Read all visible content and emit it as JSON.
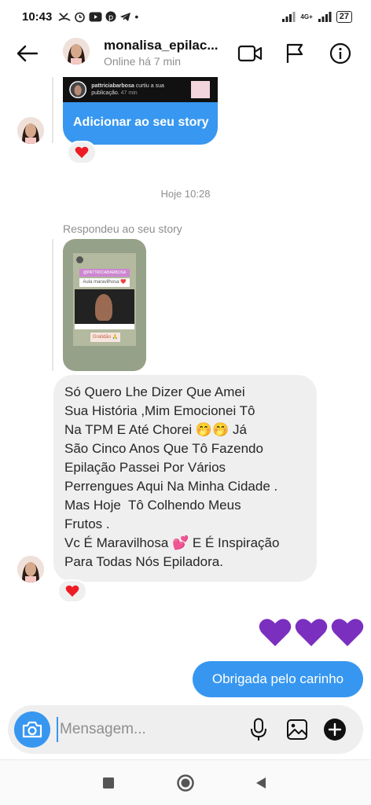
{
  "status_bar": {
    "time": "10:43",
    "network": "4G+",
    "battery": "27"
  },
  "header": {
    "name": "monalisa_epilac...",
    "status": "Online há 7 min",
    "icons": [
      "back-arrow-icon",
      "video-call-icon",
      "flag-icon",
      "info-icon"
    ]
  },
  "story_card": {
    "notification_user": "pattriciabarbosa",
    "notification_text": "curtiu a sua publicação.",
    "notification_time": "47 min",
    "button_label": "Adicionar ao seu story"
  },
  "timestamp": "Hoje 10:28",
  "reply_label": "Respondeu ao seu story",
  "story_preview": {
    "tag": "@PATTRICIABARBOSA",
    "caption": "Aula maravilhosa ❤️",
    "thanks": "Gratidão 🙏"
  },
  "received_message": "Só Quero Lhe Dizer Que Amei\nSua História ,Mim Emocionei Tô\nNa TPM E Até Chorei 🤭🤭 Já\nSão Cinco Anos Que Tô Fazendo\nEpilação Passei Por Vários\nPerrengues Aqui Na Minha Cidade .\nMas Hoje  Tô Colhendo Meus\nFrutos .\nVc É Maravilhosa 💕 E É Inspiração\nPara Todas Nós Epiladora.",
  "sent_message": "Obrigada pelo carinho",
  "composer": {
    "placeholder": "Mensagem..."
  },
  "colors": {
    "accent": "#3797f0",
    "reaction_heart": "#ed1c24",
    "sent_hearts": "#7b2fbf",
    "bubble_gray": "#efefef"
  }
}
